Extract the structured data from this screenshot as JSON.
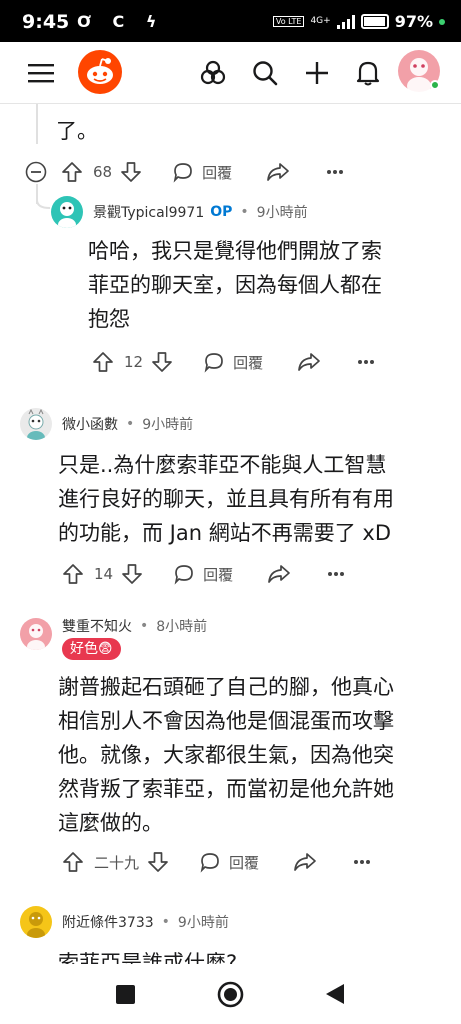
{
  "status": {
    "time": "9:45",
    "notif_icons": "Ơ C ϟ",
    "volte": "Vo LTE",
    "network": "4G+",
    "battery": "97%",
    "battery_level": 0.97
  },
  "appbar": {
    "menu_icon": "hamburger-icon",
    "logo": "reddit-snoo-logo",
    "icons": [
      "communities-icon",
      "search-icon",
      "add-icon",
      "bell-icon"
    ]
  },
  "comments": [
    {
      "text_tail": "了。",
      "votes": "68",
      "reply": "回覆"
    },
    {
      "author": "景觀Typical9971",
      "op_badge": "OP",
      "sep": "•",
      "time": "9小時前",
      "lines": [
        "哈哈，我只是覺得他們開放了索",
        "菲亞的聊天室，因為每個人都在",
        "抱怨"
      ],
      "votes": "12",
      "reply": "回覆"
    },
    {
      "author": "微小函數",
      "sep": "•",
      "time": "9小時前",
      "lines": [
        "只是..為什麼索菲亞不能與人工智慧",
        "進行良好的聊天，並且具有所有有用",
        "的功能，而 Jan 網站不再需要了 xD"
      ],
      "votes": "14",
      "reply": "回覆"
    },
    {
      "author": "雙重不知火",
      "sep": "•",
      "time": "8小時前",
      "flair": "好色😨",
      "lines": [
        "謝普搬起石頭砸了自己的腳，他真心",
        "相信別人不會因為他是個混蛋而攻擊",
        "他。就像，大家都很生氣，因為他突",
        "然背叛了索菲亞，而當初是他允許她",
        "這麼做的。"
      ],
      "votes": "二十九",
      "reply": "回覆"
    },
    {
      "author": "附近條件3733",
      "sep": "•",
      "time": "9小時前",
      "lines": [
        "索菲亞是誰或什麼?"
      ]
    }
  ],
  "colors": {
    "brand": "#ff4500",
    "op": "#0079d3",
    "flair": "#e8384f"
  }
}
